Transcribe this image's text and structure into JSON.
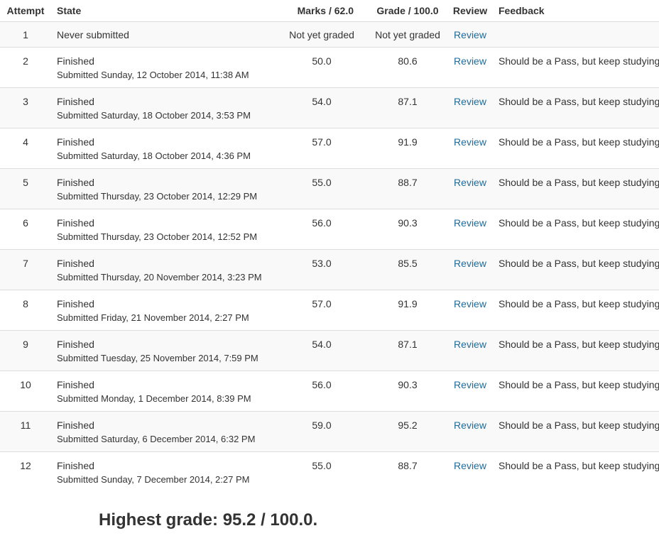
{
  "headers": {
    "attempt": "Attempt",
    "state": "State",
    "marks": "Marks / 62.0",
    "grade": "Grade / 100.0",
    "review": "Review",
    "feedback": "Feedback"
  },
  "rows": [
    {
      "attempt": "1",
      "state": "Never submitted",
      "submitted": "",
      "marks": "Not yet graded",
      "grade": "Not yet graded",
      "review": "Review",
      "feedback": ""
    },
    {
      "attempt": "2",
      "state": "Finished",
      "submitted": "Submitted Sunday, 12 October 2014, 11:38 AM",
      "marks": "50.0",
      "grade": "80.6",
      "review": "Review",
      "feedback": "Should be a Pass, but keep studying"
    },
    {
      "attempt": "3",
      "state": "Finished",
      "submitted": "Submitted Saturday, 18 October 2014, 3:53 PM",
      "marks": "54.0",
      "grade": "87.1",
      "review": "Review",
      "feedback": "Should be a Pass, but keep studying"
    },
    {
      "attempt": "4",
      "state": "Finished",
      "submitted": "Submitted Saturday, 18 October 2014, 4:36 PM",
      "marks": "57.0",
      "grade": "91.9",
      "review": "Review",
      "feedback": "Should be a Pass, but keep studying"
    },
    {
      "attempt": "5",
      "state": "Finished",
      "submitted": "Submitted Thursday, 23 October 2014, 12:29 PM",
      "marks": "55.0",
      "grade": "88.7",
      "review": "Review",
      "feedback": "Should be a Pass, but keep studying"
    },
    {
      "attempt": "6",
      "state": "Finished",
      "submitted": "Submitted Thursday, 23 October 2014, 12:52 PM",
      "marks": "56.0",
      "grade": "90.3",
      "review": "Review",
      "feedback": "Should be a Pass, but keep studying"
    },
    {
      "attempt": "7",
      "state": "Finished",
      "submitted": "Submitted Thursday, 20 November 2014, 3:23 PM",
      "marks": "53.0",
      "grade": "85.5",
      "review": "Review",
      "feedback": "Should be a Pass, but keep studying"
    },
    {
      "attempt": "8",
      "state": "Finished",
      "submitted": "Submitted Friday, 21 November 2014, 2:27 PM",
      "marks": "57.0",
      "grade": "91.9",
      "review": "Review",
      "feedback": "Should be a Pass, but keep studying"
    },
    {
      "attempt": "9",
      "state": "Finished",
      "submitted": "Submitted Tuesday, 25 November 2014, 7:59 PM",
      "marks": "54.0",
      "grade": "87.1",
      "review": "Review",
      "feedback": "Should be a Pass, but keep studying"
    },
    {
      "attempt": "10",
      "state": "Finished",
      "submitted": "Submitted Monday, 1 December 2014, 8:39 PM",
      "marks": "56.0",
      "grade": "90.3",
      "review": "Review",
      "feedback": "Should be a Pass, but keep studying"
    },
    {
      "attempt": "11",
      "state": "Finished",
      "submitted": "Submitted Saturday, 6 December 2014, 6:32 PM",
      "marks": "59.0",
      "grade": "95.2",
      "review": "Review",
      "feedback": "Should be a Pass, but keep studying"
    },
    {
      "attempt": "12",
      "state": "Finished",
      "submitted": "Submitted Sunday, 7 December 2014, 2:27 PM",
      "marks": "55.0",
      "grade": "88.7",
      "review": "Review",
      "feedback": "Should be a Pass, but keep studying"
    }
  ],
  "summary": "Highest grade: 95.2 / 100.0.",
  "colors": {
    "link": "#1f6b9a",
    "stripe": "#f9f9f9",
    "border": "#dddddd",
    "text": "#333333"
  }
}
